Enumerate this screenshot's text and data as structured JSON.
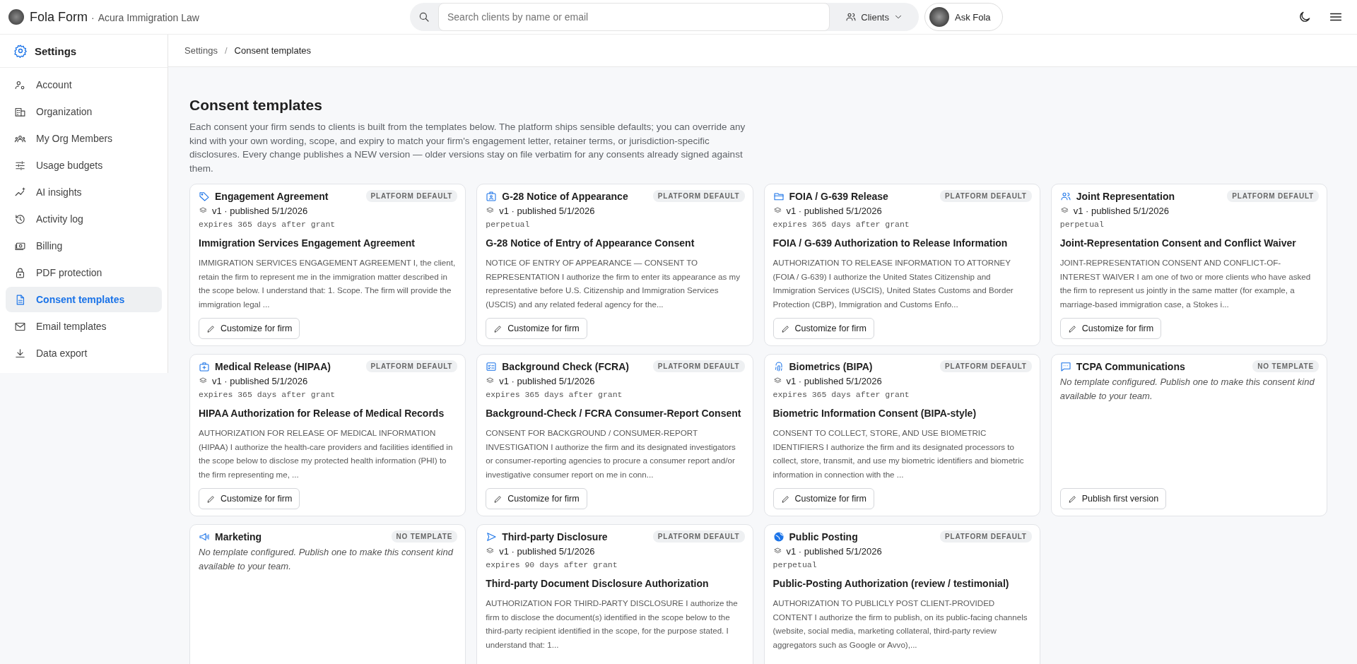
{
  "header": {
    "app_name": "Fola Form",
    "separator": "·",
    "org_name": "Acura Immigration Law",
    "search": {
      "placeholder": "Search clients by name or email"
    },
    "scope_button": "Clients",
    "assistant_button": "Ask Fola"
  },
  "sidebar": {
    "title": "Settings",
    "items": [
      {
        "label": "Account",
        "selected": false
      },
      {
        "label": "Organization",
        "selected": false
      },
      {
        "label": "My Org Members",
        "selected": false
      },
      {
        "label": "Usage budgets",
        "selected": false
      },
      {
        "label": "AI insights",
        "selected": false
      },
      {
        "label": "Activity log",
        "selected": false
      },
      {
        "label": "Billing",
        "selected": false
      },
      {
        "label": "PDF protection",
        "selected": false
      },
      {
        "label": "Consent templates",
        "selected": true
      },
      {
        "label": "Email templates",
        "selected": false
      },
      {
        "label": "Data export",
        "selected": false
      }
    ]
  },
  "breadcrumb": {
    "separator": "/",
    "items": [
      "Settings",
      "Consent templates"
    ]
  },
  "page": {
    "title": "Consent templates",
    "description": "Each consent your firm sends to clients is built from the templates below. The platform ships sensible defaults; you can override any kind with your own wording, scope, and expiry to match your firm's engagement letter, retainer terms, or jurisdiction-specific disclosures. Every change publishes a NEW version — older versions stay on file verbatim for any consents already signed against them."
  },
  "cards": [
    {
      "kind": "template",
      "title": "Engagement Agreement",
      "badge": "PLATFORM DEFAULT",
      "version": "v1 · published 5/1/2026",
      "expiry": "expires 365 days after grant",
      "heading": "Immigration Services Engagement Agreement",
      "body": "IMMIGRATION SERVICES ENGAGEMENT AGREEMENT I, the client, retain the firm to represent me in the immigration matter described in the scope below. I understand that: 1. Scope. The firm will provide the immigration legal ...",
      "action": "Customize for firm"
    },
    {
      "kind": "template",
      "title": "G-28 Notice of Appearance",
      "badge": "PLATFORM DEFAULT",
      "version": "v1 · published 5/1/2026",
      "expiry": "perpetual",
      "heading": "G-28 Notice of Entry of Appearance Consent",
      "body": "NOTICE OF ENTRY OF APPEARANCE — CONSENT TO REPRESENTATION I authorize the firm to enter its appearance as my representative before U.S. Citizenship and Immigration Services (USCIS) and any related federal agency for the...",
      "action": "Customize for firm"
    },
    {
      "kind": "template",
      "title": "FOIA / G-639 Release",
      "badge": "PLATFORM DEFAULT",
      "version": "v1 · published 5/1/2026",
      "expiry": "expires 365 days after grant",
      "heading": "FOIA / G-639 Authorization to Release Information",
      "body": "AUTHORIZATION TO RELEASE INFORMATION TO ATTORNEY (FOIA / G-639) I authorize the United States Citizenship and Immigration Services (USCIS), United States Customs and Border Protection (CBP), Immigration and Customs Enfo...",
      "action": "Customize for firm"
    },
    {
      "kind": "template",
      "title": "Joint Representation",
      "badge": "PLATFORM DEFAULT",
      "version": "v1 · published 5/1/2026",
      "expiry": "perpetual",
      "heading": "Joint-Representation Consent and Conflict Waiver",
      "body": "JOINT-REPRESENTATION CONSENT AND CONFLICT-OF-INTEREST WAIVER I am one of two or more clients who have asked the firm to represent us jointly in the same matter (for example, a marriage-based immigration case, a Stokes i...",
      "action": "Customize for firm"
    },
    {
      "kind": "template",
      "title": "Medical Release (HIPAA)",
      "badge": "PLATFORM DEFAULT",
      "version": "v1 · published 5/1/2026",
      "expiry": "expires 365 days after grant",
      "heading": "HIPAA Authorization for Release of Medical Records",
      "body": "AUTHORIZATION FOR RELEASE OF MEDICAL INFORMATION (HIPAA) I authorize the health-care providers and facilities identified in the scope below to disclose my protected health information (PHI) to the firm representing me, ...",
      "action": "Customize for firm"
    },
    {
      "kind": "template",
      "title": "Background Check (FCRA)",
      "badge": "PLATFORM DEFAULT",
      "version": "v1 · published 5/1/2026",
      "expiry": "expires 365 days after grant",
      "heading": "Background-Check / FCRA Consumer-Report Consent",
      "body": "CONSENT FOR BACKGROUND / CONSUMER-REPORT INVESTIGATION I authorize the firm and its designated investigators or consumer-reporting agencies to procure a consumer report and/or investigative consumer report on me in conn...",
      "action": "Customize for firm"
    },
    {
      "kind": "template",
      "title": "Biometrics (BIPA)",
      "badge": "PLATFORM DEFAULT",
      "version": "v1 · published 5/1/2026",
      "expiry": "expires 365 days after grant",
      "heading": "Biometric Information Consent (BIPA-style)",
      "body": "CONSENT TO COLLECT, STORE, AND USE BIOMETRIC IDENTIFIERS I authorize the firm and its designated processors to collect, store, transmit, and use my biometric identifiers and biometric information in connection with the ...",
      "action": "Customize for firm"
    },
    {
      "kind": "empty",
      "title": "TCPA Communications",
      "badge": "NO TEMPLATE",
      "note": "No template configured. Publish one to make this consent kind available to your team.",
      "action": "Publish first version"
    },
    {
      "kind": "empty",
      "title": "Marketing",
      "badge": "NO TEMPLATE",
      "note": "No template configured. Publish one to make this consent kind available to your team."
    },
    {
      "kind": "template",
      "title": "Third-party Disclosure",
      "badge": "PLATFORM DEFAULT",
      "version": "v1 · published 5/1/2026",
      "expiry": "expires 90 days after grant",
      "heading": "Third-party Document Disclosure Authorization",
      "body": "AUTHORIZATION FOR THIRD-PARTY DISCLOSURE I authorize the firm to disclose the document(s) identified in the scope below to the third-party recipient identified in the scope, for the purpose stated. I understand that: 1..."
    },
    {
      "kind": "template",
      "title": "Public Posting",
      "badge": "PLATFORM DEFAULT",
      "version": "v1 · published 5/1/2026",
      "expiry": "perpetual",
      "heading": "Public-Posting Authorization (review / testimonial)",
      "body": "AUTHORIZATION TO PUBLICLY POST CLIENT-PROVIDED CONTENT I authorize the firm to publish, on its public-facing channels (website, social media, marketing collateral, third-party review aggregators such as Google or Avvo),..."
    }
  ]
}
